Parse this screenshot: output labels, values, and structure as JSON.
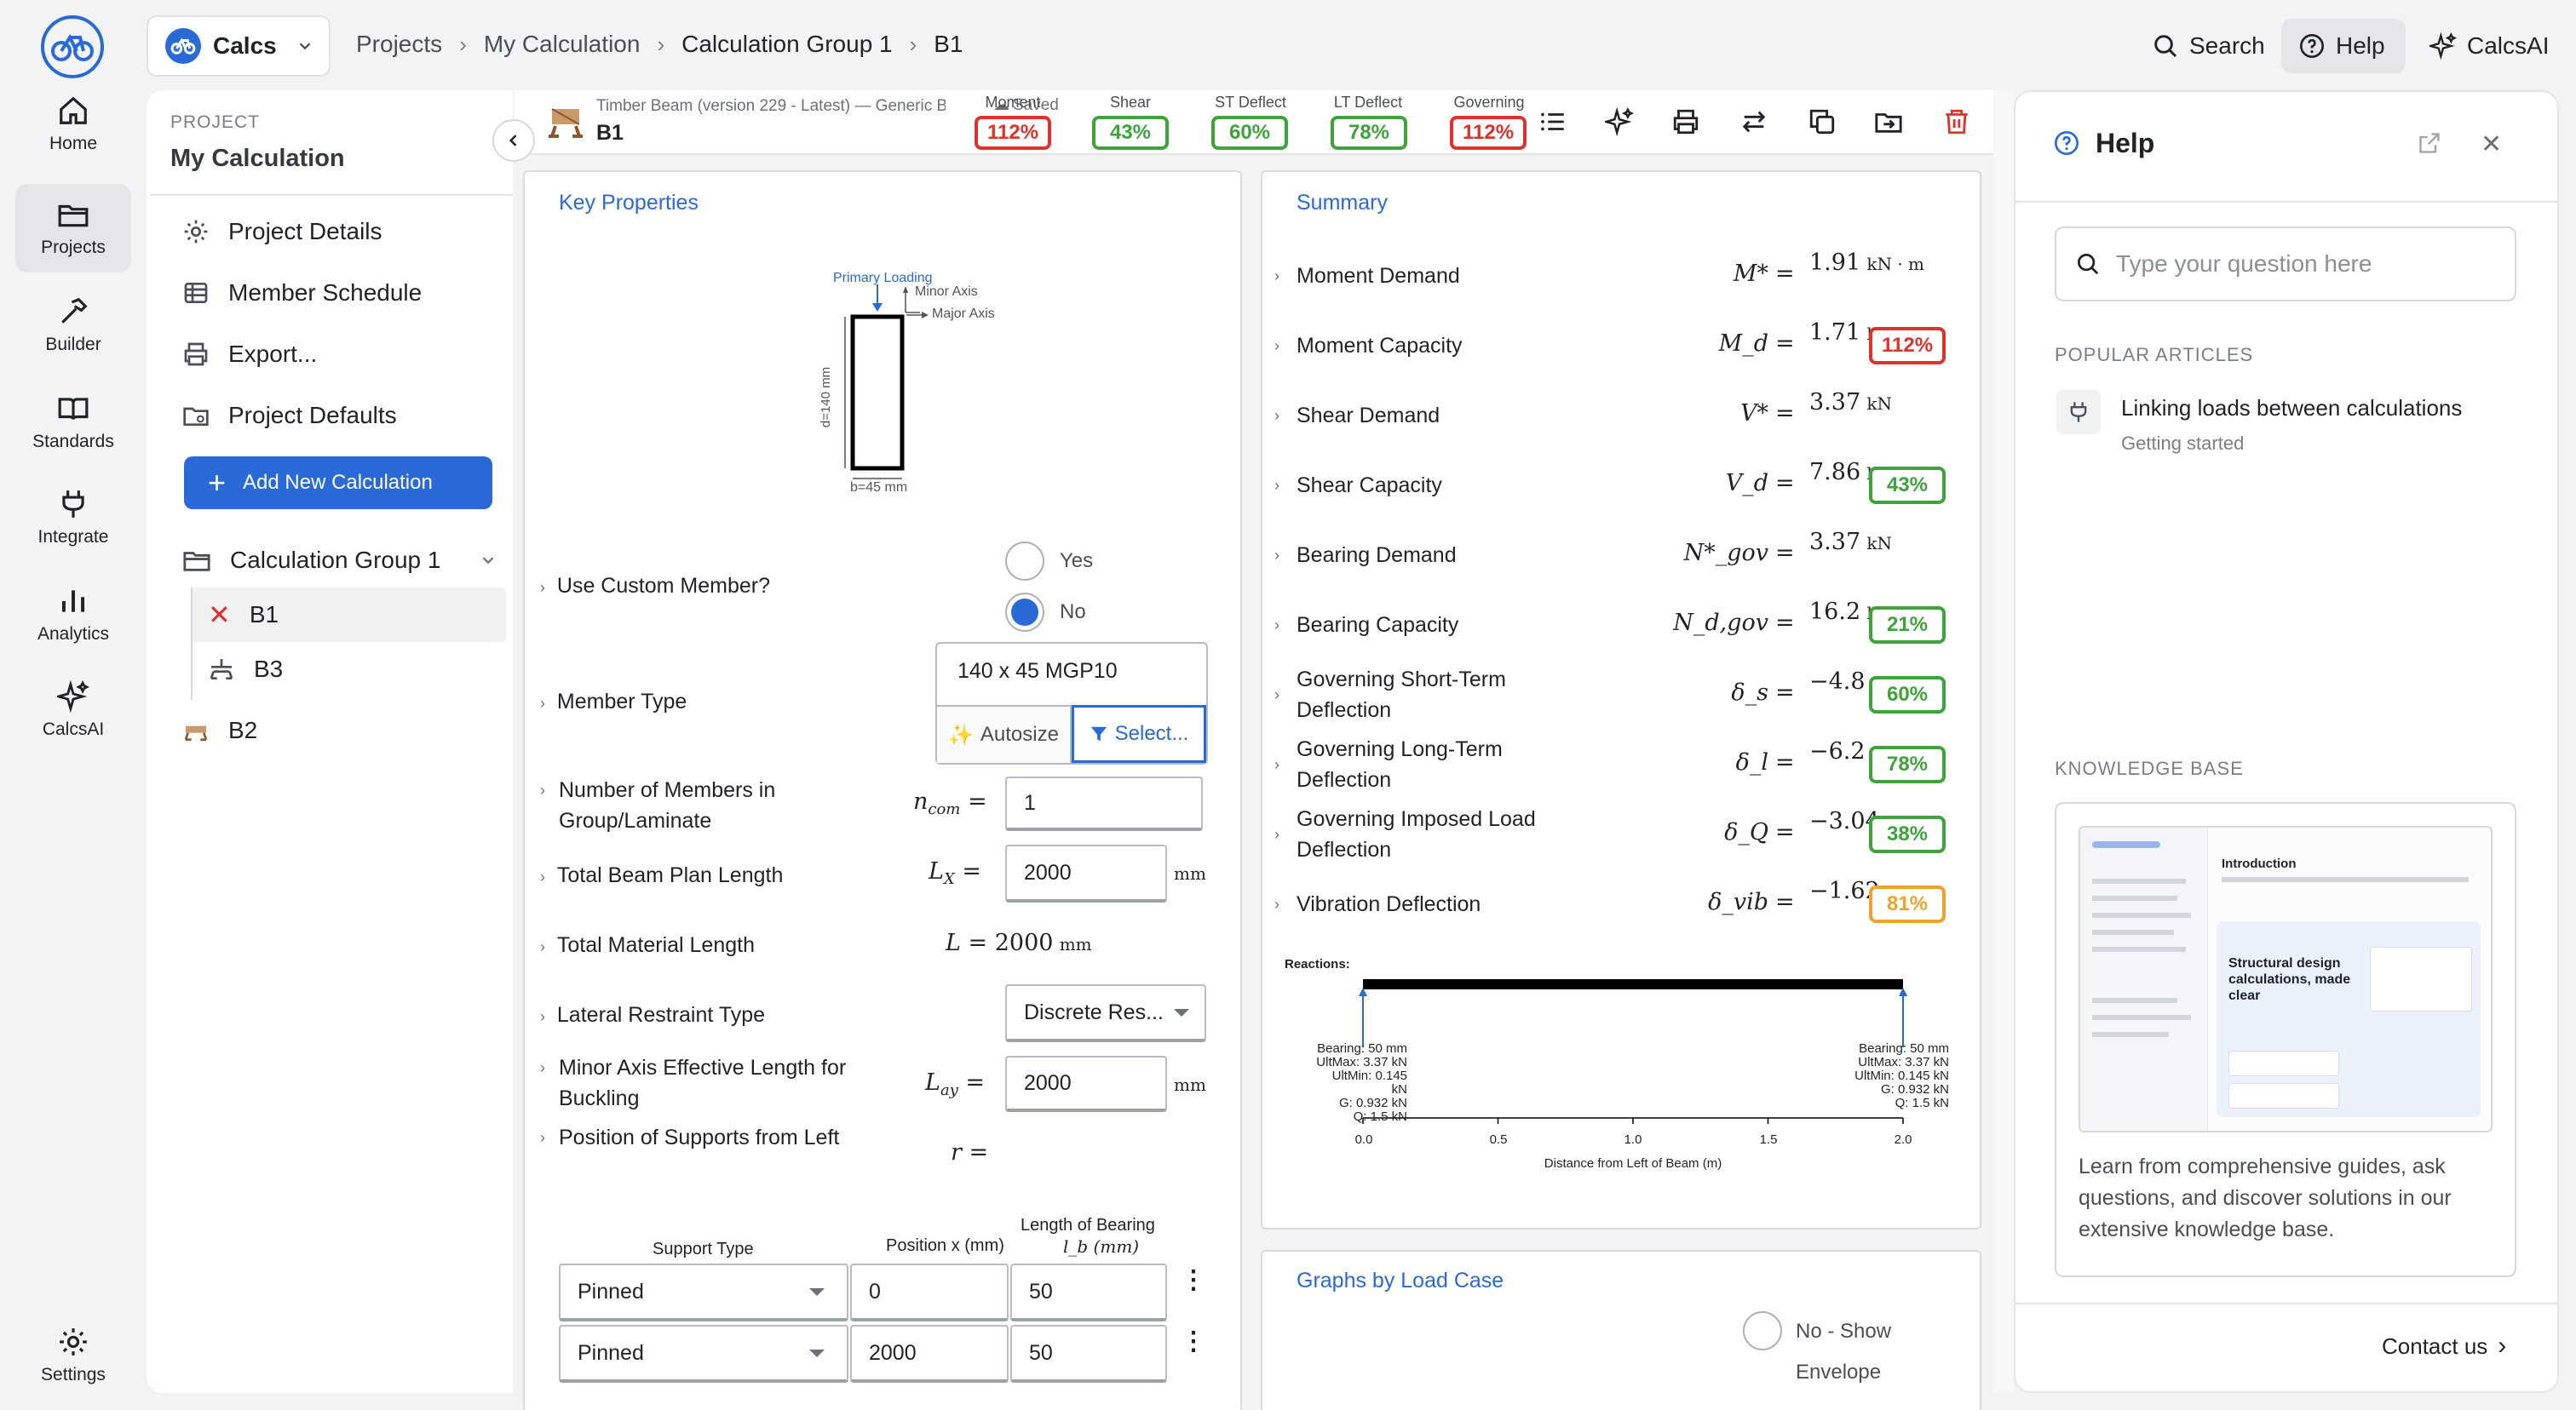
{
  "rail": {
    "items": [
      {
        "label": "Home",
        "icon": "home-icon"
      },
      {
        "label": "Projects",
        "icon": "folder-icon",
        "active": true
      },
      {
        "label": "Builder",
        "icon": "hammer-icon"
      },
      {
        "label": "Standards",
        "icon": "book-icon"
      },
      {
        "label": "Integrate",
        "icon": "plug-icon"
      },
      {
        "label": "Analytics",
        "icon": "bar-chart-icon"
      },
      {
        "label": "CalcsAI",
        "icon": "sparkle-icon"
      }
    ],
    "settings": "Settings"
  },
  "topbar": {
    "app_switcher": "Calcs",
    "breadcrumb": [
      "Projects",
      "My Calculation",
      "Calculation Group 1",
      "B1"
    ],
    "search": "Search",
    "help": "Help",
    "calcsai": "CalcsAI"
  },
  "project": {
    "label": "PROJECT",
    "name": "My Calculation",
    "links": [
      "Project Details",
      "Member Schedule",
      "Export...",
      "Project Defaults"
    ],
    "add_button": "Add New Calculation",
    "group": "Calculation Group 1",
    "group_items": [
      "B1",
      "B3"
    ],
    "other_items": [
      "B2"
    ]
  },
  "calc_header": {
    "title": "Timber Beam (version 229 - Latest) — Generic Be",
    "name": "B1",
    "saved": "Saved",
    "badges": [
      {
        "label": "Moment",
        "value": "112%",
        "status": "red"
      },
      {
        "label": "Shear",
        "value": "43%",
        "status": "green"
      },
      {
        "label": "ST Deflect",
        "value": "60%",
        "status": "green"
      },
      {
        "label": "LT Deflect",
        "value": "78%",
        "status": "green"
      },
      {
        "label": "Governing",
        "value": "112%",
        "status": "red"
      }
    ]
  },
  "key_properties": {
    "title": "Key Properties",
    "diagram": {
      "primary": "Primary Loading",
      "minor": "Minor Axis",
      "major": "Major Axis",
      "d": "d=140 mm",
      "b": "b=45 mm"
    },
    "custom_member": {
      "label": "Use Custom Member?",
      "yes": "Yes",
      "no": "No",
      "selected": "No"
    },
    "member_type": {
      "label": "Member Type",
      "value": "140 x 45 MGP10",
      "autosize": "Autosize",
      "select": "Select..."
    },
    "n_members": {
      "label": "Number of Members in Group/Laminate",
      "symbol": "n",
      "sub": "com",
      "value": "1"
    },
    "plan_length": {
      "label": "Total Beam Plan Length",
      "symbol": "L",
      "sub": "X",
      "value": "2000",
      "unit": "mm"
    },
    "material_length": {
      "label": "Total Material Length",
      "symbol": "L",
      "value": "2000",
      "unit": "mm"
    },
    "lateral_restraint": {
      "label": "Lateral Restraint Type",
      "value": "Discrete Res..."
    },
    "minor_axis": {
      "label": "Minor Axis Effective Length for Buckling",
      "symbol": "L",
      "sub": "ay",
      "value": "2000",
      "unit": "mm"
    },
    "supports_pos": {
      "label": "Position of Supports from Left",
      "symbol": "r"
    },
    "support_table": {
      "headers": [
        "Support Type",
        "Position x (mm)",
        "Length of Bearing",
        "l_b (mm)"
      ],
      "rows": [
        {
          "type": "Pinned",
          "position": "0",
          "bearing": "50"
        },
        {
          "type": "Pinned",
          "position": "2000",
          "bearing": "50"
        }
      ]
    }
  },
  "summary": {
    "title": "Summary",
    "rows": [
      {
        "label": "Moment Demand",
        "sym": "M*",
        "value": "1.91",
        "unit": "kN · m",
        "badge": ""
      },
      {
        "label": "Moment Capacity",
        "sym": "M_d",
        "value": "1.71",
        "unit": "kN · m",
        "badge": "112%",
        "status": "red"
      },
      {
        "label": "Shear Demand",
        "sym": "V*",
        "value": "3.37",
        "unit": "kN",
        "badge": ""
      },
      {
        "label": "Shear Capacity",
        "sym": "V_d",
        "value": "7.86",
        "unit": "kN",
        "badge": "43%",
        "status": "green"
      },
      {
        "label": "Bearing Demand",
        "sym": "N*_gov",
        "value": "3.37",
        "unit": "kN",
        "badge": ""
      },
      {
        "label": "Bearing Capacity",
        "sym": "N_d,gov",
        "value": "16.2",
        "unit": "kN",
        "badge": "21%",
        "status": "green"
      },
      {
        "label": "Governing Short-Term Deflection",
        "sym": "δ_s",
        "value": "−4.8",
        "unit": "mm",
        "badge": "60%",
        "status": "green"
      },
      {
        "label": "Governing Long-Term Deflection",
        "sym": "δ_l",
        "value": "−6.2",
        "unit": "mm",
        "badge": "78%",
        "status": "green"
      },
      {
        "label": "Governing Imposed Load Deflection",
        "sym": "δ_Q",
        "value": "−3.04",
        "unit": "mm",
        "badge": "38%",
        "status": "green"
      },
      {
        "label": "Vibration Deflection",
        "sym": "δ_vib",
        "value": "−1.62",
        "unit": "mm",
        "badge": "81%",
        "status": "orange"
      }
    ],
    "reactions": {
      "title": "Reactions:",
      "left": [
        "Bearing: 50 mm",
        "UltMax: 3.37 kN",
        "UltMin: 0.145 kN",
        "G: 0.932 kN",
        "Q: 1.5 kN"
      ],
      "right": [
        "Bearing: 50 mm",
        "UltMax: 3.37 kN",
        "UltMin: 0.145 kN",
        "G: 0.932 kN",
        "Q: 1.5 kN"
      ],
      "ticks": [
        "0.0",
        "0.5",
        "1.0",
        "1.5",
        "2.0"
      ],
      "xlabel": "Distance from Left of Beam (m)"
    }
  },
  "graphs": {
    "title": "Graphs by Load Case",
    "option": "No - Show",
    "option2": "Envelope"
  },
  "help": {
    "title": "Help",
    "search_placeholder": "Type your question here",
    "popular_label": "POPULAR ARTICLES",
    "article_title": "Linking loads between calculations",
    "article_sub": "Getting started",
    "kb_label": "KNOWLEDGE BASE",
    "kb_text": "Learn from comprehensive guides, ask questions, and discover solutions in our extensive knowledge base.",
    "contact": "Contact us",
    "thumb": {
      "heading": "Introduction",
      "hero": "Structural design calculations, made clear"
    }
  }
}
